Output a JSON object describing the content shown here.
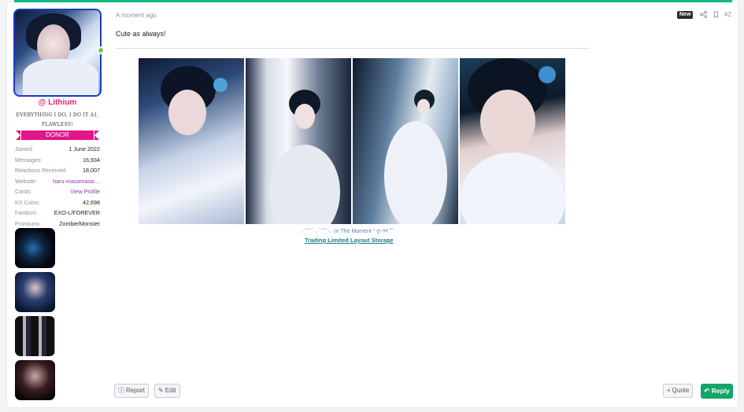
{
  "user": {
    "name": "@ Lithium",
    "title": "everything i do, i do it a1, flawless!",
    "banner": "DONOR",
    "info": [
      {
        "key": "Joined:",
        "value": "1 June 2022",
        "link": false
      },
      {
        "key": "Messages:",
        "value": "16,934",
        "link": false
      },
      {
        "key": "Reactions Received:",
        "value": "18,007",
        "link": false
      },
      {
        "key": "Website:",
        "value": "haru-masamasa....",
        "link": true
      },
      {
        "key": "Cards:",
        "value": "View Profile",
        "link": true
      },
      {
        "key": "KS Coins:",
        "value": "42,698",
        "link": false
      },
      {
        "key": "Fandom:",
        "value": "EXO-L/FOREVER",
        "link": false
      },
      {
        "key": "Pronouns:",
        "value": "Zombie/Monster",
        "link": false
      }
    ]
  },
  "post": {
    "time": "A moment ago",
    "new_label": "New",
    "number": "#2",
    "message": "Cute as always!",
    "signature_line1": ".·´¨˜¨`·.·´¨˜¨`·.· In The Moment ° ღ ୨୧ ˜˜",
    "signature_link": "Trading Limited Layout Storage"
  },
  "actions": {
    "report": "Report",
    "edit": "Edit",
    "quote": "Quote",
    "reply": "Reply"
  },
  "colors": {
    "accent": "#12b886",
    "username": "#e0246e",
    "banner": "#e2158a",
    "reply": "#13a56a"
  }
}
